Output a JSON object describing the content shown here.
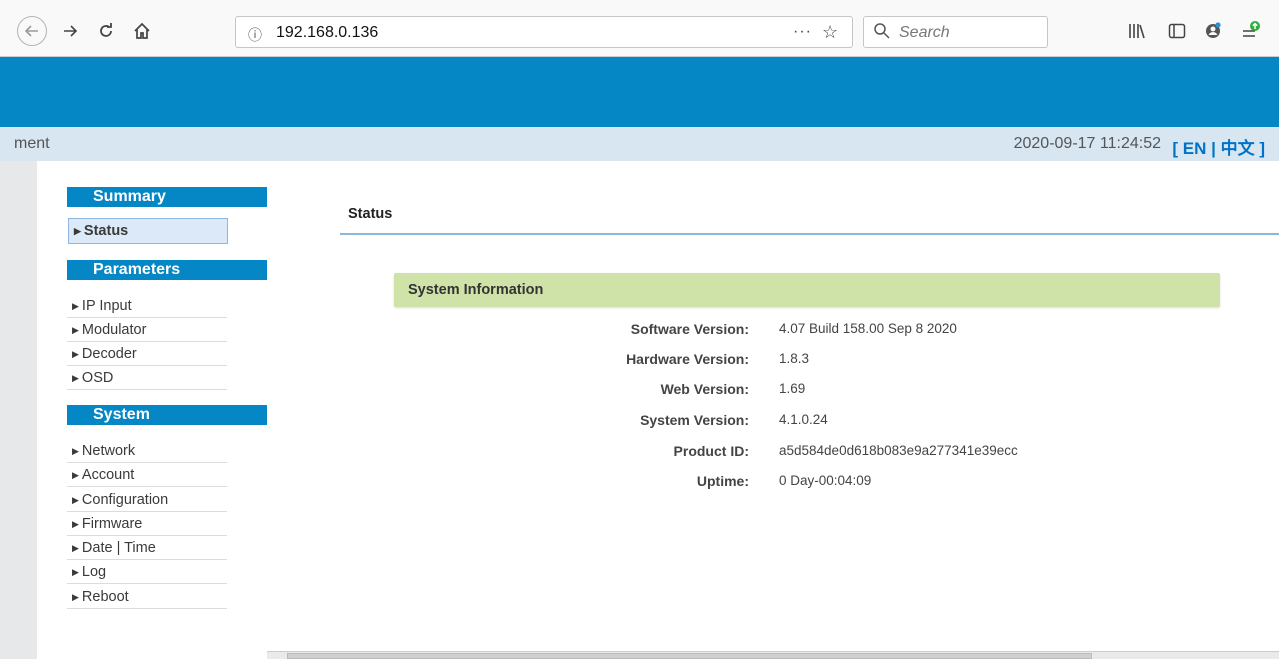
{
  "browser": {
    "url": "192.168.0.136",
    "url_info_icon": "info-icon",
    "search_placeholder": "Search",
    "more_dots": "···"
  },
  "header": {
    "breadcrumb": "ment",
    "datetime": "2020-09-17 11:24:52",
    "language_switch": "[ EN | 中文 ]"
  },
  "sidebar": {
    "sections": [
      {
        "title": "Summary",
        "items": [
          {
            "label": "Status",
            "active": true
          }
        ]
      },
      {
        "title": "Parameters",
        "items": [
          {
            "label": "IP Input"
          },
          {
            "label": "Modulator"
          },
          {
            "label": "Decoder"
          },
          {
            "label": "OSD"
          }
        ]
      },
      {
        "title": "System",
        "items": [
          {
            "label": "Network"
          },
          {
            "label": "Account"
          },
          {
            "label": "Configuration"
          },
          {
            "label": "Firmware"
          },
          {
            "label": "Date | Time"
          },
          {
            "label": "Log"
          },
          {
            "label": "Reboot"
          }
        ]
      }
    ]
  },
  "main": {
    "title": "Status",
    "panel_title": "System Information",
    "rows": [
      {
        "label": "Software Version:",
        "value": "4.07 Build 158.00 Sep 8 2020"
      },
      {
        "label": "Hardware Version:",
        "value": "1.8.3"
      },
      {
        "label": "Web Version:",
        "value": "1.69"
      },
      {
        "label": "System Version:",
        "value": "4.1.0.24"
      },
      {
        "label": "Product ID:",
        "value": "a5d584de0d618b083e9a277341e39ecc"
      },
      {
        "label": "Uptime:",
        "value": "0 Day-00:04:09"
      }
    ]
  },
  "colors": {
    "banner": "#0587c5",
    "subbar": "#d7e6f1",
    "section_header": "#0587c5",
    "panel_header": "#cfe3a9",
    "lang_link": "#0073c8"
  }
}
